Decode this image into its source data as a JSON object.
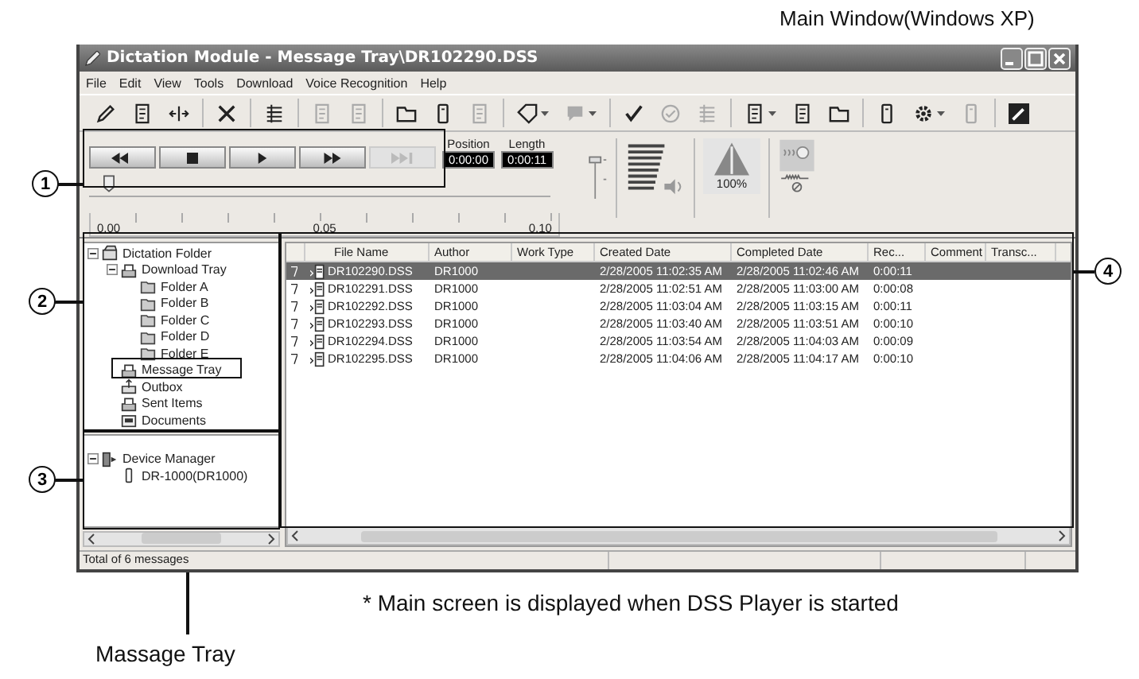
{
  "caption": "Main Window(Windows XP)",
  "window": {
    "title": "Dictation Module - Message Tray\\DR102290.DSS"
  },
  "menu": [
    "File",
    "Edit",
    "View",
    "Tools",
    "Download",
    "Voice Recognition",
    "Help"
  ],
  "toolbar": [
    {
      "kind": "pen",
      "disabled": false,
      "dropdown": false
    },
    {
      "kind": "doc",
      "disabled": false,
      "dropdown": false
    },
    {
      "kind": "split",
      "disabled": false,
      "dropdown": false
    },
    {
      "kind": "delete",
      "disabled": false,
      "dropdown": false
    },
    {
      "kind": "list",
      "disabled": false,
      "dropdown": false
    },
    {
      "kind": "doc",
      "disabled": true,
      "dropdown": false
    },
    {
      "kind": "doc",
      "disabled": true,
      "dropdown": false
    },
    {
      "kind": "folder",
      "disabled": false,
      "dropdown": false
    },
    {
      "kind": "device",
      "disabled": false,
      "dropdown": false
    },
    {
      "kind": "doc",
      "disabled": true,
      "dropdown": false
    },
    {
      "kind": "tag",
      "disabled": false,
      "dropdown": true
    },
    {
      "kind": "speech",
      "disabled": true,
      "dropdown": true
    },
    {
      "kind": "check",
      "disabled": false,
      "dropdown": false
    },
    {
      "kind": "circle-check",
      "disabled": true,
      "dropdown": false
    },
    {
      "kind": "list",
      "disabled": true,
      "dropdown": false
    },
    {
      "kind": "doc",
      "disabled": false,
      "dropdown": true
    },
    {
      "kind": "doc",
      "disabled": false,
      "dropdown": false
    },
    {
      "kind": "folder",
      "disabled": false,
      "dropdown": false
    },
    {
      "kind": "device",
      "disabled": false,
      "dropdown": false
    },
    {
      "kind": "gear",
      "disabled": false,
      "dropdown": true
    },
    {
      "kind": "device",
      "disabled": true,
      "dropdown": false
    },
    {
      "kind": "wand",
      "disabled": false,
      "dropdown": false
    }
  ],
  "transport": [
    {
      "kind": "rewind",
      "disabled": false
    },
    {
      "kind": "stop",
      "disabled": false
    },
    {
      "kind": "play",
      "disabled": false
    },
    {
      "kind": "fast-forward",
      "disabled": false
    },
    {
      "kind": "skip-end",
      "disabled": true
    }
  ],
  "position": {
    "label": "Position",
    "value": "0:00:00"
  },
  "length": {
    "label": "Length",
    "value": "0:00:11"
  },
  "playback_slider": {
    "level": 0.03
  },
  "ruler": [
    "0.00",
    "0.05",
    "0.10"
  ],
  "speed": {
    "reading": "100%"
  },
  "folder_tree": [
    {
      "label": "Dictation Folder",
      "kind": "cabinet",
      "expanded": true,
      "selected": false,
      "children": [
        {
          "label": "Download Tray",
          "kind": "tray",
          "expanded": true,
          "selected": false,
          "children": [
            {
              "label": "Folder A",
              "kind": "folder",
              "selected": false
            },
            {
              "label": "Folder B",
              "kind": "folder",
              "selected": false
            },
            {
              "label": "Folder C",
              "kind": "folder",
              "selected": false
            },
            {
              "label": "Folder D",
              "kind": "folder",
              "selected": false
            },
            {
              "label": "Folder E",
              "kind": "folder",
              "selected": false
            }
          ]
        },
        {
          "label": "Message Tray",
          "kind": "inbox",
          "selected": false
        },
        {
          "label": "Outbox",
          "kind": "outbox",
          "selected": false
        },
        {
          "label": "Sent Items",
          "kind": "tray",
          "selected": false
        },
        {
          "label": "Documents",
          "kind": "documents",
          "selected": false
        }
      ]
    }
  ],
  "device_tree": [
    {
      "label": "Device Manager",
      "kind": "device-group",
      "expanded": true,
      "selected": false,
      "children": [
        {
          "label": "DR-1000(DR1000)",
          "kind": "recorder",
          "selected": false
        }
      ]
    }
  ],
  "table": {
    "columns": [
      "File Name",
      "Author",
      "Work Type",
      "Created Date",
      "Completed Date",
      "Rec...",
      "Comment",
      "Transc..."
    ],
    "rows": [
      {
        "selected": true,
        "file": "DR102290.DSS",
        "author": "DR1000",
        "created": "2/28/2005 11:02:35 AM",
        "completed": "2/28/2005 11:02:46 AM",
        "rec": "0:00:11"
      },
      {
        "selected": false,
        "file": "DR102291.DSS",
        "author": "DR1000",
        "created": "2/28/2005 11:02:51 AM",
        "completed": "2/28/2005 11:03:00 AM",
        "rec": "0:00:08"
      },
      {
        "selected": false,
        "file": "DR102292.DSS",
        "author": "DR1000",
        "created": "2/28/2005 11:03:04 AM",
        "completed": "2/28/2005 11:03:15 AM",
        "rec": "0:00:11"
      },
      {
        "selected": false,
        "file": "DR102293.DSS",
        "author": "DR1000",
        "created": "2/28/2005 11:03:40 AM",
        "completed": "2/28/2005 11:03:51 AM",
        "rec": "0:00:10"
      },
      {
        "selected": false,
        "file": "DR102294.DSS",
        "author": "DR1000",
        "created": "2/28/2005 11:03:54 AM",
        "completed": "2/28/2005 11:04:03 AM",
        "rec": "0:00:09"
      },
      {
        "selected": false,
        "file": "DR102295.DSS",
        "author": "DR1000",
        "created": "2/28/2005 11:04:06 AM",
        "completed": "2/28/2005 11:04:17 AM",
        "rec": "0:00:10"
      }
    ]
  },
  "status_bar": "Total of 6 messages",
  "callouts": [
    "1",
    "2",
    "3",
    "4"
  ],
  "footnote": "* Main screen is displayed when DSS Player is started",
  "pointer_label": "Massage Tray"
}
